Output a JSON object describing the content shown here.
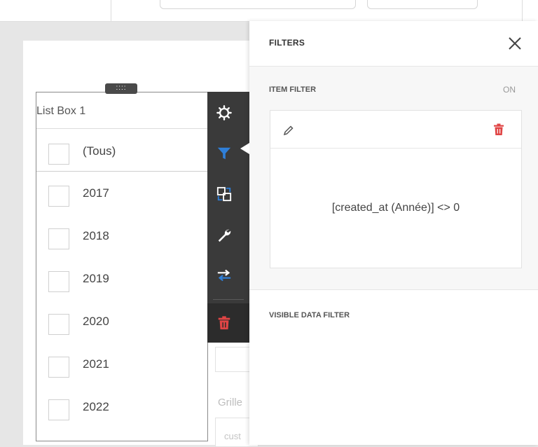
{
  "listbox": {
    "title": "List Box 1",
    "handle": "::::",
    "items": [
      {
        "label": "(Tous)",
        "checked": false
      },
      {
        "label": "2017",
        "checked": false
      },
      {
        "label": "2018",
        "checked": false
      },
      {
        "label": "2019",
        "checked": false
      },
      {
        "label": "2020",
        "checked": false
      },
      {
        "label": "2021",
        "checked": false
      },
      {
        "label": "2022",
        "checked": false
      }
    ]
  },
  "toolbar": {
    "buttons": [
      {
        "name": "settings",
        "icon": "gear-icon"
      },
      {
        "name": "filters",
        "icon": "filter-icon",
        "active": true
      },
      {
        "name": "interactivity",
        "icon": "interactivity-icon"
      },
      {
        "name": "options",
        "icon": "wrench-icon"
      },
      {
        "name": "convert",
        "icon": "convert-arrows-icon"
      },
      {
        "name": "delete",
        "icon": "trash-icon"
      }
    ]
  },
  "background": {
    "grille_text": "Grille",
    "cust_text": "cust"
  },
  "filters_panel": {
    "title": "FILTERS",
    "item_filter": {
      "label": "ITEM FILTER",
      "state": "ON",
      "expression": "[created_at (Année)] <> 0"
    },
    "visible_data_filter": {
      "label": "VISIBLE DATA FILTER"
    }
  },
  "colors": {
    "toolbar_bg": "#3a3a3a",
    "accent_blue": "#2f7fd8",
    "delete_red": "#e04545",
    "panel_bg": "#ffffff",
    "section_bg": "#f7f7f7"
  }
}
